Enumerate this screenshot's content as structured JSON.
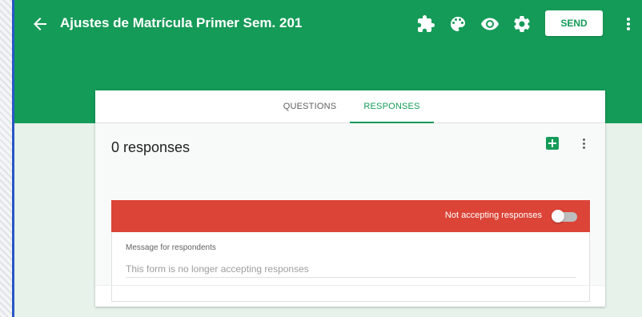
{
  "header": {
    "title": "Ajustes de Matrícula Primer Sem. 201",
    "send_label": "SEND",
    "background_color": "#159b58",
    "icons": [
      "back-arrow-icon",
      "addons-puzzle-icon",
      "palette-icon",
      "preview-eye-icon",
      "settings-gear-icon",
      "more-vert-icon"
    ]
  },
  "tabs": [
    {
      "label": "QUESTIONS",
      "active": false
    },
    {
      "label": "RESPONSES",
      "active": true
    }
  ],
  "responses": {
    "count_label": "0 responses",
    "accepting_label": "Not accepting responses",
    "accepting": false,
    "accepting_bar_color": "#db4437",
    "message_label": "Message for respondents",
    "message_placeholder": "This form is no longer accepting responses"
  }
}
